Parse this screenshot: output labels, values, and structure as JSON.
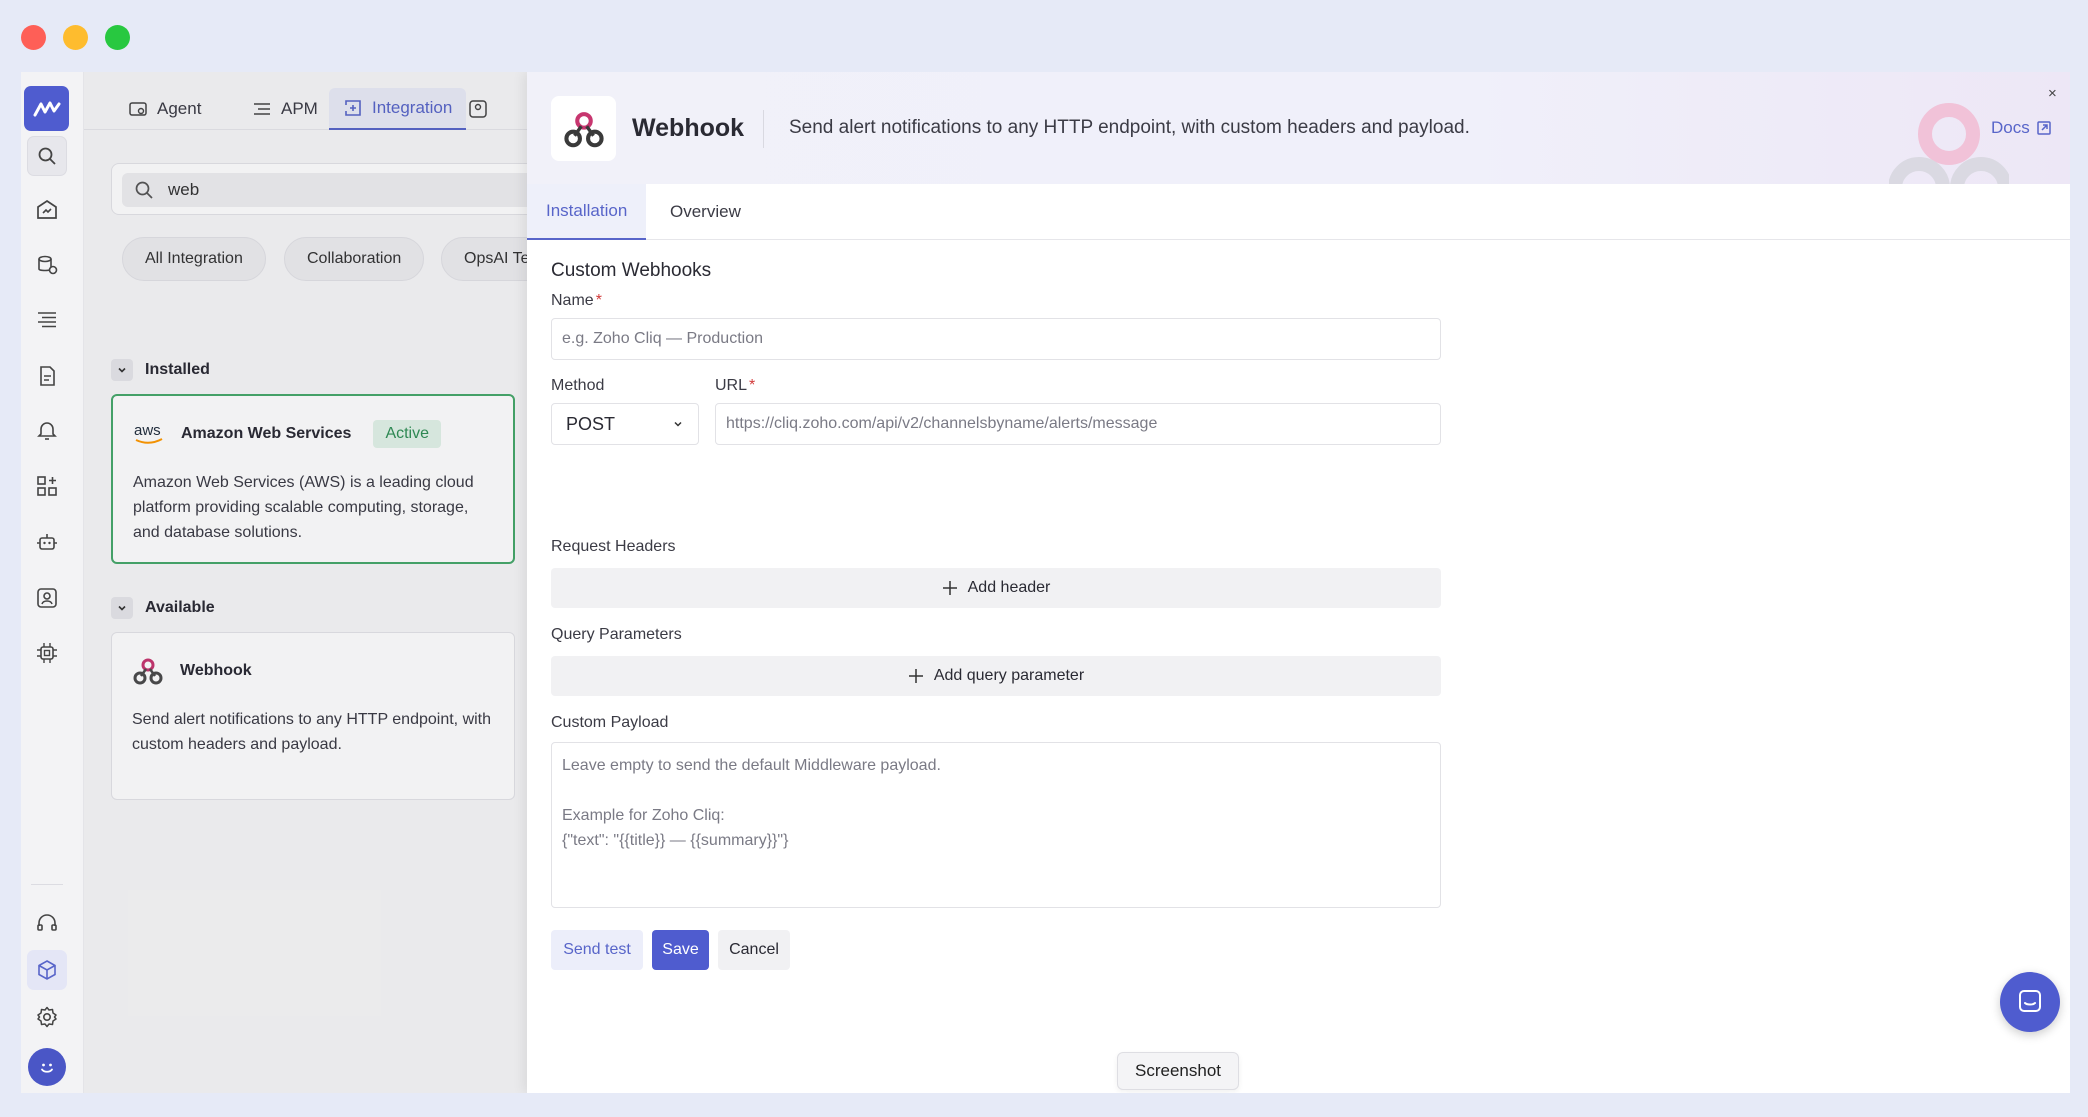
{
  "colors": {
    "accent": "#5865c9",
    "primary_button": "#4f5ccf",
    "active_green": "#47a86b",
    "required": "#d23a3a",
    "traffic_red": "#fe5f57",
    "traffic_yellow": "#febc2e",
    "traffic_green": "#28c840"
  },
  "rail": {
    "logo": "middleware-logo-icon",
    "icons": [
      "search-icon",
      "dashboard-icon",
      "infrastructure-icon",
      "logs-icon",
      "reports-icon",
      "alerts-icon",
      "integrations-grid-icon",
      "bot-icon",
      "user-monitor-icon",
      "chip-icon",
      "support-headset-icon",
      "package-icon",
      "settings-icon",
      "avatar-icon"
    ]
  },
  "top_tabs": [
    {
      "label": "Agent",
      "icon": "agent-icon"
    },
    {
      "label": "APM",
      "icon": "apm-icon"
    },
    {
      "label": "Integration",
      "icon": "integration-icon"
    }
  ],
  "search": {
    "value": "web"
  },
  "filters": [
    "All Integration",
    "Collaboration",
    "OpsAI Te"
  ],
  "installed": {
    "heading": "Installed",
    "card": {
      "name": "Amazon Web Services",
      "badge": "Active",
      "logo_text": "aws",
      "description": "Amazon Web Services (AWS) is a leading cloud platform providing scalable computing, storage, and database solutions."
    }
  },
  "available": {
    "heading": "Available",
    "card": {
      "name": "Webhook",
      "description": "Send alert notifications to any HTTP endpoint, with custom headers and payload."
    }
  },
  "drawer": {
    "title": "Webhook",
    "subtitle": "Send alert notifications to any HTTP endpoint, with custom headers and payload.",
    "docs_label": "Docs",
    "close_label": "×",
    "tabs": [
      "Installation",
      "Overview"
    ],
    "form": {
      "section_title": "Custom Webhooks",
      "name_label": "Name",
      "name_placeholder": "e.g. Zoho Cliq — Production",
      "method_label": "Method",
      "method_value": "POST",
      "url_label": "URL",
      "url_placeholder": "https://cliq.zoho.com/api/v2/channelsbyname/alerts/message",
      "headers_label": "Request Headers",
      "add_header": "Add header",
      "query_label": "Query Parameters",
      "add_query": "Add query parameter",
      "payload_label": "Custom Payload",
      "payload_placeholder": "Leave empty to send the default Middleware payload.\n\nExample for Zoho Cliq:\n{\"text\": \"{{title}} — {{summary}}\"}",
      "send_test": "Send test",
      "save": "Save",
      "cancel": "Cancel"
    }
  },
  "tooltip": "Screenshot"
}
